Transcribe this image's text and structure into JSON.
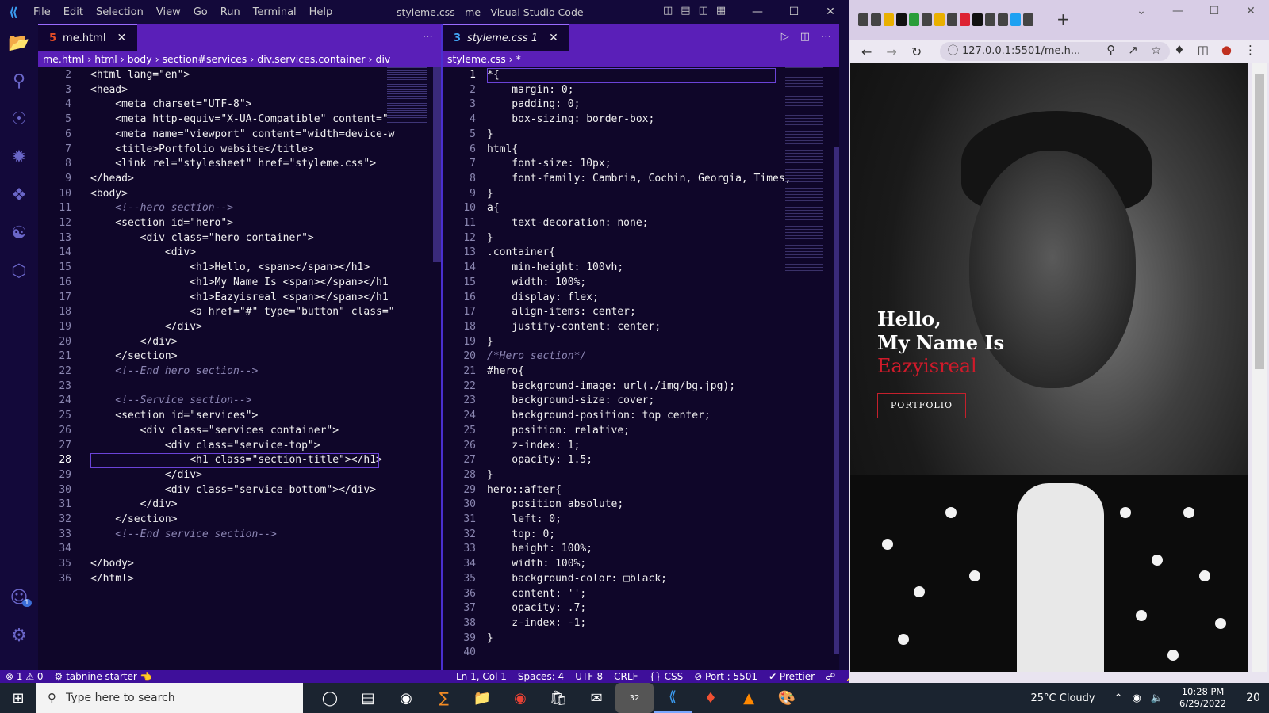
{
  "vscode": {
    "window_title": "styleme.css - me - Visual Studio Code",
    "menu": [
      "File",
      "Edit",
      "Selection",
      "View",
      "Go",
      "Run",
      "Terminal",
      "Help"
    ],
    "tabs_left": [
      {
        "label": "me.html",
        "icon": "html5-icon"
      }
    ],
    "tabs_right": [
      {
        "label": "styleme.css 1",
        "icon": "css3-icon"
      }
    ],
    "breadcrumb_left": "me.html › html › body › section#services › div.services.container › div",
    "breadcrumb_right": "styleme.css › *",
    "html_lines": [
      {
        "n": "2",
        "t": "<html lang=\"en\">"
      },
      {
        "n": "3",
        "t": "<head>"
      },
      {
        "n": "4",
        "t": "    <meta charset=\"UTF-8\">"
      },
      {
        "n": "5",
        "t": "    <meta http-equiv=\"X-UA-Compatible\" content=\""
      },
      {
        "n": "6",
        "t": "    <meta name=\"viewport\" content=\"width=device-w"
      },
      {
        "n": "7",
        "t": "    <title>Portfolio website</title>"
      },
      {
        "n": "8",
        "t": "    <link rel=\"stylesheet\" href=\"styleme.css\">"
      },
      {
        "n": "9",
        "t": "</head>"
      },
      {
        "n": "10",
        "t": "<body>"
      },
      {
        "n": "11",
        "t": "    <!--hero section-->"
      },
      {
        "n": "12",
        "t": "    <section id=\"hero\">"
      },
      {
        "n": "13",
        "t": "        <div class=\"hero container\">"
      },
      {
        "n": "14",
        "t": "            <div>"
      },
      {
        "n": "15",
        "t": "                <h1>Hello, <span></span></h1>"
      },
      {
        "n": "16",
        "t": "                <h1>My Name Is <span></span></h1"
      },
      {
        "n": "17",
        "t": "                <h1>Eazyisreal <span></span></h1"
      },
      {
        "n": "18",
        "t": "                <a href=\"#\" type=\"button\" class=\""
      },
      {
        "n": "19",
        "t": "            </div>"
      },
      {
        "n": "20",
        "t": "        </div>"
      },
      {
        "n": "21",
        "t": "    </section>"
      },
      {
        "n": "22",
        "t": "    <!--End hero section-->"
      },
      {
        "n": "23",
        "t": ""
      },
      {
        "n": "24",
        "t": "    <!--Service section-->"
      },
      {
        "n": "25",
        "t": "    <section id=\"services\">"
      },
      {
        "n": "26",
        "t": "        <div class=\"services container\">"
      },
      {
        "n": "27",
        "t": "            <div class=\"service-top\">"
      },
      {
        "n": "28",
        "t": "                <h1 class=\"section-title\"></h1>"
      },
      {
        "n": "29",
        "t": "            </div>"
      },
      {
        "n": "30",
        "t": "            <div class=\"service-bottom\"></div>"
      },
      {
        "n": "31",
        "t": "        </div>"
      },
      {
        "n": "32",
        "t": "    </section>"
      },
      {
        "n": "33",
        "t": "    <!--End service section-->"
      },
      {
        "n": "34",
        "t": ""
      },
      {
        "n": "35",
        "t": "</body>"
      },
      {
        "n": "36",
        "t": "</html>"
      }
    ],
    "css_lines": [
      {
        "n": "1",
        "t": "*{"
      },
      {
        "n": "2",
        "t": "    margin: 0;"
      },
      {
        "n": "3",
        "t": "    padding: 0;"
      },
      {
        "n": "4",
        "t": "    box-sizing: border-box;"
      },
      {
        "n": "5",
        "t": "}"
      },
      {
        "n": "6",
        "t": "html{"
      },
      {
        "n": "7",
        "t": "    font-size: 10px;"
      },
      {
        "n": "8",
        "t": "    font-family: Cambria, Cochin, Georgia, Times,"
      },
      {
        "n": "9",
        "t": "}"
      },
      {
        "n": "10",
        "t": "a{"
      },
      {
        "n": "11",
        "t": "    text-decoration: none;"
      },
      {
        "n": "12",
        "t": "}"
      },
      {
        "n": "13",
        "t": ".container{"
      },
      {
        "n": "14",
        "t": "    min-height: 100vh;"
      },
      {
        "n": "15",
        "t": "    width: 100%;"
      },
      {
        "n": "16",
        "t": "    display: flex;"
      },
      {
        "n": "17",
        "t": "    align-items: center;"
      },
      {
        "n": "18",
        "t": "    justify-content: center;"
      },
      {
        "n": "19",
        "t": "}"
      },
      {
        "n": "20",
        "t": "/*Hero section*/"
      },
      {
        "n": "21",
        "t": "#hero{"
      },
      {
        "n": "22",
        "t": "    background-image: url(./img/bg.jpg);"
      },
      {
        "n": "23",
        "t": "    background-size: cover;"
      },
      {
        "n": "24",
        "t": "    background-position: top center;"
      },
      {
        "n": "25",
        "t": "    position: relative;"
      },
      {
        "n": "26",
        "t": "    z-index: 1;"
      },
      {
        "n": "27",
        "t": "    opacity: 1.5;"
      },
      {
        "n": "28",
        "t": "}"
      },
      {
        "n": "29",
        "t": "hero::after{"
      },
      {
        "n": "30",
        "t": "    position absolute;"
      },
      {
        "n": "31",
        "t": "    left: 0;"
      },
      {
        "n": "32",
        "t": "    top: 0;"
      },
      {
        "n": "33",
        "t": "    height: 100%;"
      },
      {
        "n": "34",
        "t": "    width: 100%;"
      },
      {
        "n": "35",
        "t": "    background-color: □black;"
      },
      {
        "n": "36",
        "t": "    content: '';"
      },
      {
        "n": "37",
        "t": "    opacity: .7;"
      },
      {
        "n": "38",
        "t": "    z-index: -1;"
      },
      {
        "n": "39",
        "t": "}"
      },
      {
        "n": "40",
        "t": ""
      }
    ],
    "status_left": [
      "⊗ 1 ⚠ 0",
      "⚙ tabnine starter 👈"
    ],
    "status_right": [
      "Ln 1, Col 1",
      "Spaces: 4",
      "UTF-8",
      "CRLF",
      "{} CSS",
      "⊘ Port : 5501",
      "✔ Prettier"
    ],
    "accounts_badge": "1"
  },
  "browser": {
    "url": "127.0.0.1:5501/me.h...",
    "hero": {
      "line1": "Hello,",
      "line2": "My Name Is",
      "line3": "Eazyisreal",
      "button": "PORTFOLIO"
    }
  },
  "taskbar": {
    "search_placeholder": "Type here to search",
    "badge_count": "32",
    "weather": "25°C  Cloudy",
    "time": "10:28 PM",
    "date": "6/29/2022",
    "notification_count": "20"
  }
}
